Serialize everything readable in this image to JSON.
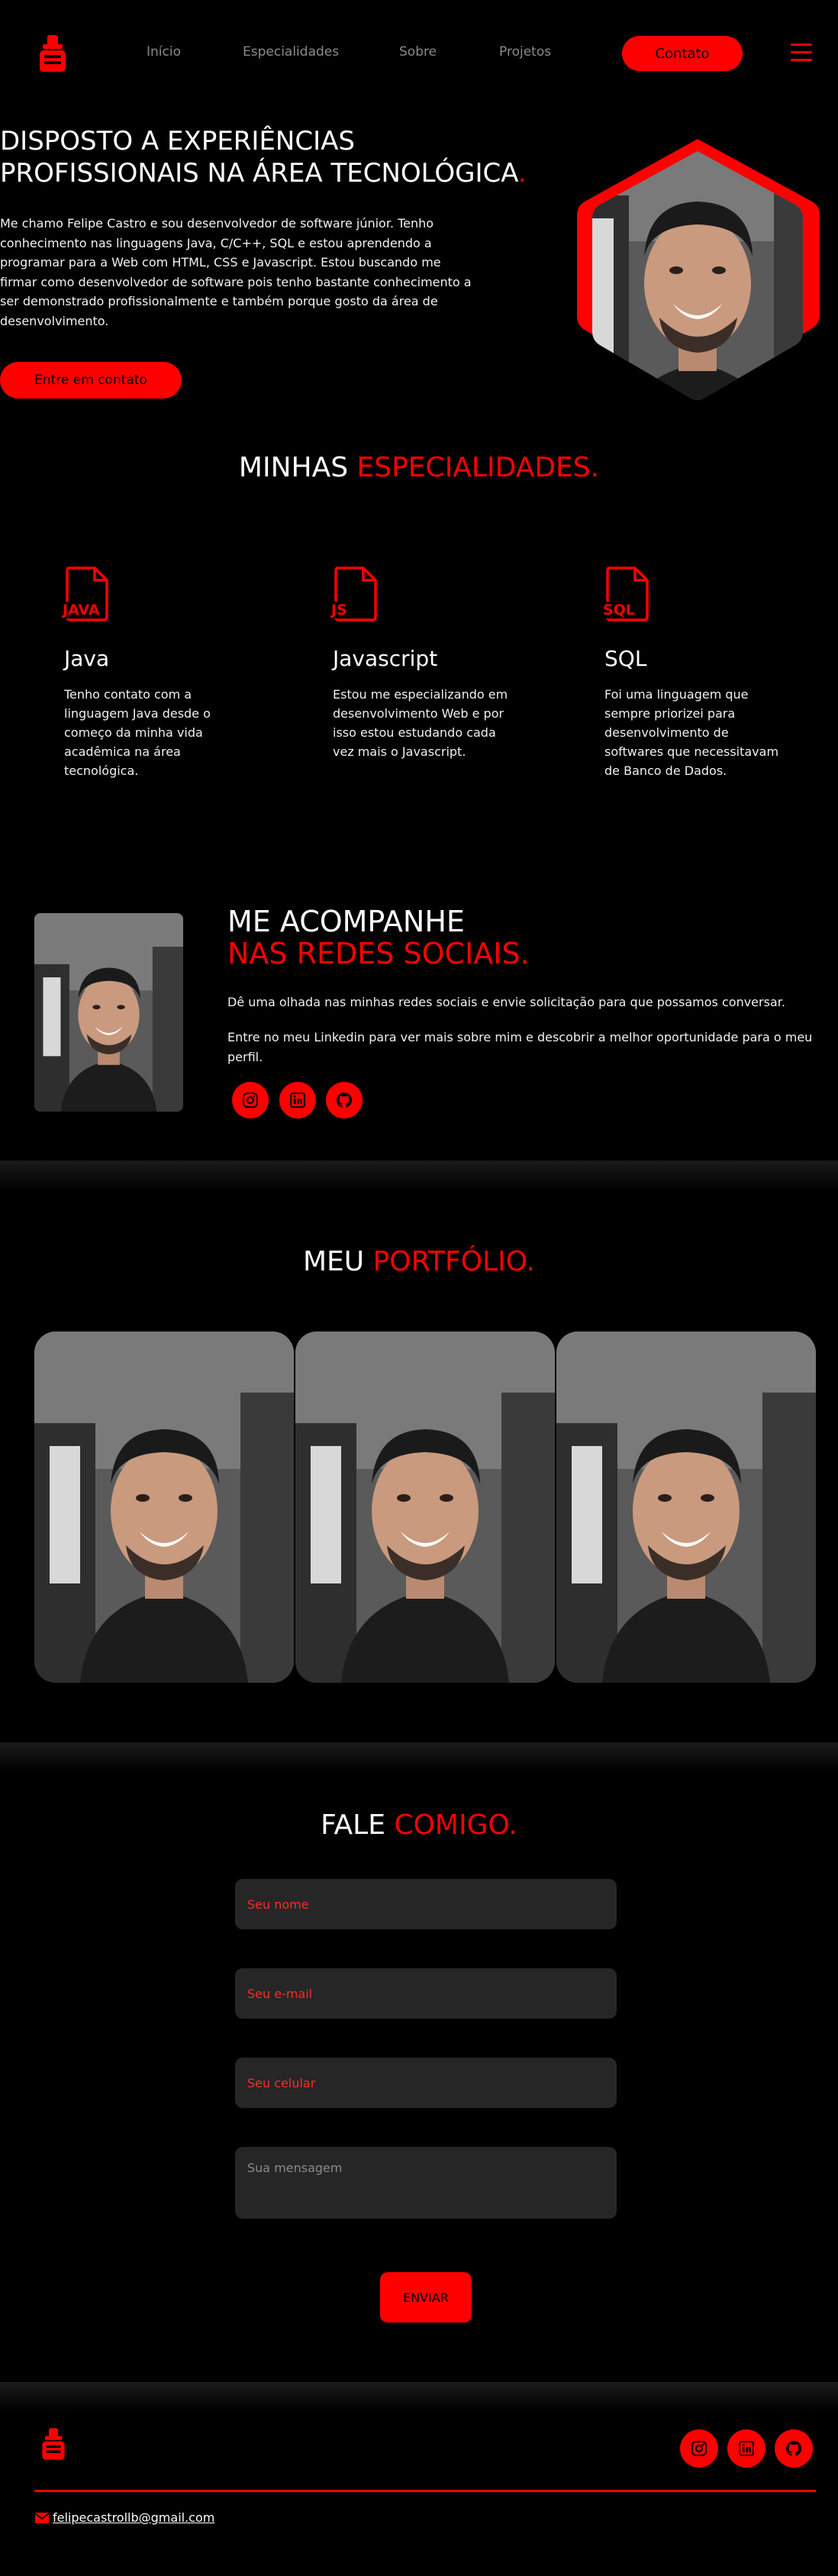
{
  "nav": {
    "links": [
      "Início",
      "Especialidades",
      "Sobre",
      "Projetos"
    ],
    "contact_button": "Contato"
  },
  "hero": {
    "title_line1": "DISPOSTO A EXPERIÊNCIAS",
    "title_line2": "PROFISSIONAIS NA ÁREA TECNOLÓGICA",
    "title_dot": ".",
    "text": "Me chamo Felipe Castro e sou desenvolvedor de software júnior. Tenho conhecimento nas linguagens Java, C/C++, SQL e estou aprendendo a programar para a Web com HTML, CSS e Javascript. Estou buscando me firmar como desenvolvedor de software pois tenho bastante conhecimento a ser demonstrado profissionalmente e também porque gosto da área de desenvolvimento.",
    "cta": "Entre em contato"
  },
  "specialties": {
    "title_white": "MINHAS",
    "title_red": "ESPECIALIDADES.",
    "cards": [
      {
        "badge": "JAVA",
        "name": "Java",
        "text": "Tenho contato com a linguagem Java desde o começo da minha vida acadêmica na área tecnológica."
      },
      {
        "badge": "JS",
        "name": "Javascript",
        "text": "Estou me especializando em desenvolvimento Web e por isso estou estudando cada vez mais o Javascript."
      },
      {
        "badge": "SQL",
        "name": "SQL",
        "text": "Foi uma linguagem que sempre priorizei para desenvolvimento de softwares que necessitavam de Banco de Dados."
      }
    ]
  },
  "social": {
    "title_white": "ME ACOMPANHE",
    "title_red": "NAS REDES SOCIAIS.",
    "p1": "Dê uma olhada nas minhas redes sociais e envie solicitação para que possamos conversar.",
    "p2": "Entre no meu Linkedin para ver mais sobre mim e descobrir a melhor oportunidade para o meu perfil."
  },
  "portfolio": {
    "title_white": "MEU",
    "title_red": "PORTFÓLIO."
  },
  "contact": {
    "title_white": "FALE",
    "title_red": "COMIGO.",
    "name_placeholder": "Seu nome",
    "email_placeholder": "Seu e-mail",
    "phone_placeholder": "Seu celular",
    "message_placeholder": "Sua mensagem",
    "submit": "ENVIAR"
  },
  "footer": {
    "email": "felipecastrollb@gmail.com"
  },
  "colors": {
    "accent": "#ff0000",
    "background": "#000000",
    "field": "#262626"
  }
}
